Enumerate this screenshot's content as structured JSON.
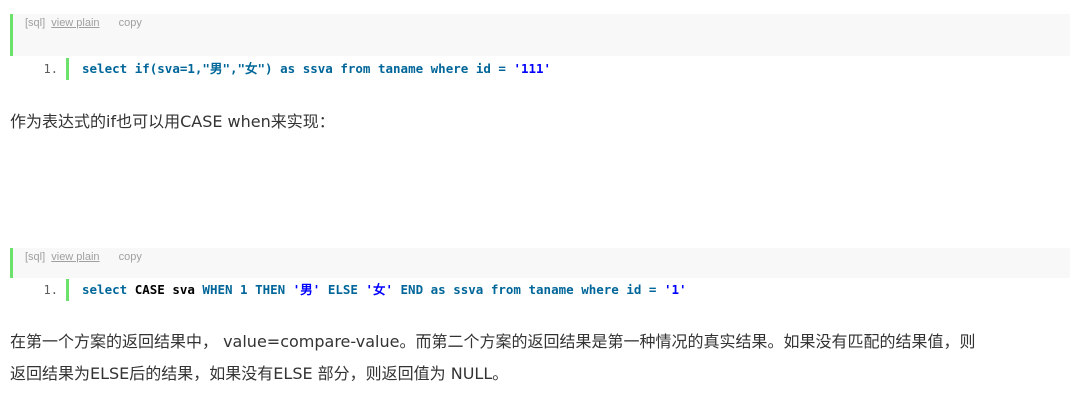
{
  "block1": {
    "lang_tag": "[sql]",
    "view_plain": "view plain",
    "copy": "copy",
    "line_number": "1.",
    "code": {
      "t1": "select ",
      "t2": "if(sva=1,\"男\",\"女\") ",
      "t3": "as ",
      "t4": "ssva ",
      "t5": "from ",
      "t6": "taname ",
      "t7": "where ",
      "t8": "id = ",
      "t9": "'111'"
    }
  },
  "para1": "作为表达式的if也可以用CASE when来实现：",
  "block2": {
    "lang_tag": "[sql]",
    "view_plain": "view plain",
    "copy": "copy",
    "line_number": "1.",
    "code": {
      "t1": "select ",
      "t2": "CASE sva ",
      "t3": "WHEN 1 THEN ",
      "t4": "'男' ",
      "t5": "ELSE ",
      "t6": "'女' ",
      "t7": "END ",
      "t8": "as ",
      "t9": "ssva ",
      "t10": "from ",
      "t11": "taname ",
      "t12": "where ",
      "t13": "id = ",
      "t14": "'1'"
    }
  },
  "para2_line1": "在第一个方案的返回结果中， value=compare-value。而第二个方案的返回结果是第一种情况的真实结果。如果没有匹配的结果值，则",
  "para2_line2": "返回结果为ELSE后的结果，如果没有ELSE 部分，则返回值为 NULL。"
}
